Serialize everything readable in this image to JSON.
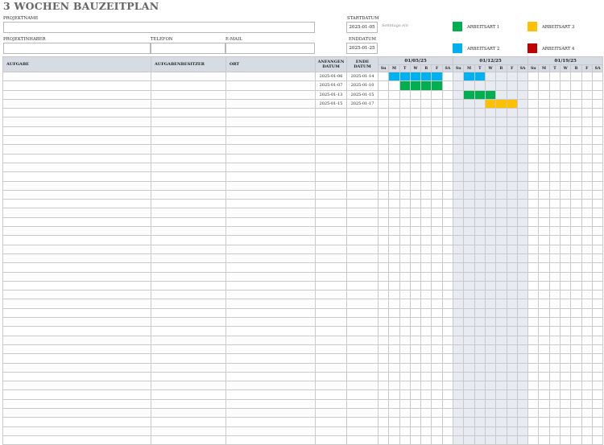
{
  "title": "3 WOCHEN BAUZEITPLAN",
  "fields": {
    "project_name_label": "PROJEKTNAME",
    "project_owner_label": "PROJEKTINHABER",
    "phone_label": "TELEFON",
    "email_label": "E-MAIL",
    "start_label": "STARTDATUM",
    "start_value": "2025-01-05",
    "end_label": "ENDDATUM",
    "end_value": "2025-01-25",
    "note_line1": "Sonntags ein",
    "project_name_value": "",
    "project_owner_value": "",
    "phone_value": "",
    "email_value": ""
  },
  "legend": [
    {
      "label": "ARBEITSART 1",
      "color": "#00b050"
    },
    {
      "label": "ARBEITSART 3",
      "color": "#ffc000"
    },
    {
      "label": "ARBEITSART 2",
      "color": "#00b0f0"
    },
    {
      "label": "ARBEITSART 4",
      "color": "#c00000"
    }
  ],
  "table": {
    "headers": {
      "task": "AUFGABE",
      "owner": "AUFGABENBESITZER",
      "location": "ORT",
      "start": "ANFANGEN DATUM",
      "end": "ENDE DATUM"
    },
    "weeks": [
      "01/05/25",
      "01/12/25",
      "01/19/25"
    ],
    "day_labels": [
      "Su",
      "M",
      "T",
      "W",
      "R",
      "F",
      "SA"
    ],
    "rows": [
      {
        "start": "2025-01-06",
        "end": "2025-01-14",
        "bar_color": "#00b0f0"
      },
      {
        "start": "2025-01-07",
        "end": "2025-01-10",
        "bar_color": "#00b050"
      },
      {
        "start": "2025-01-13",
        "end": "2025-01-15",
        "bar_color": "#00b050"
      },
      {
        "start": "2025-01-15",
        "end": "2025-01-17",
        "bar_color": "#ffc000"
      }
    ],
    "empty_rows": 37
  }
}
